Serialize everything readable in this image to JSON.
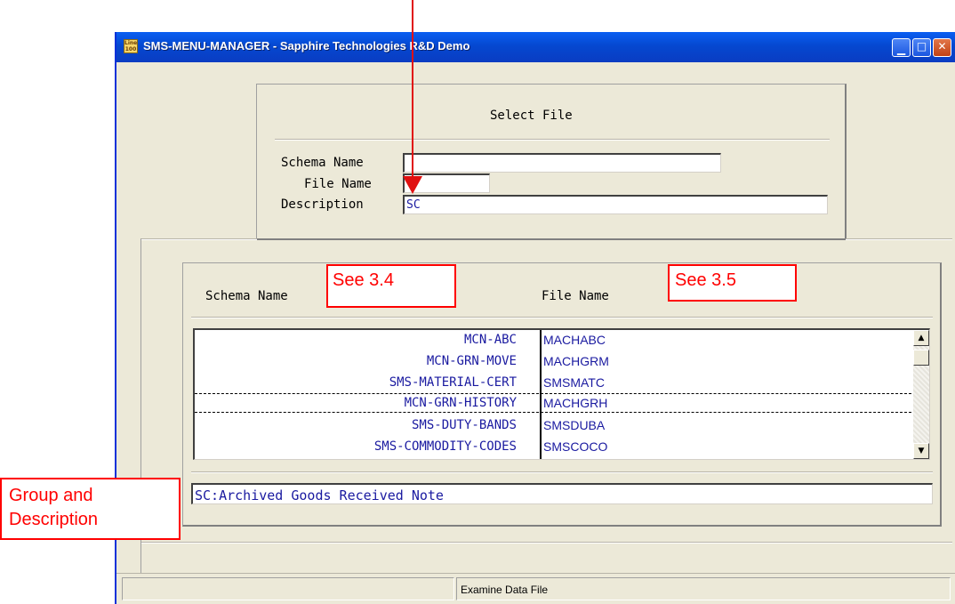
{
  "window": {
    "title": "SMS-MENU-MANAGER - Sapphire Technologies R&D Demo",
    "app_icon_text": [
      "Line",
      "100"
    ],
    "icons": {
      "minimize": "minimize-icon",
      "maximize": "maximize-icon",
      "close": "close-icon"
    }
  },
  "select_file": {
    "heading": "Select File",
    "schema_label": "Schema Name",
    "schema_value": "",
    "file_label": "File Name",
    "file_value": "",
    "description_label": "Description",
    "description_value": "SC"
  },
  "results": {
    "col_schema": "Schema Name",
    "col_file": "File Name",
    "rows": [
      {
        "schema": "MCN-ABC",
        "file": "MACHABC"
      },
      {
        "schema": "MCN-GRN-MOVE",
        "file": "MACHGRM"
      },
      {
        "schema": "SMS-MATERIAL-CERT",
        "file": "SMSMATC"
      },
      {
        "schema": "MCN-GRN-HISTORY",
        "file": "MACHGRH"
      },
      {
        "schema": "SMS-DUTY-BANDS",
        "file": "SMSDUBA"
      },
      {
        "schema": "SMS-COMMODITY-CODES",
        "file": "SMSCOCO"
      }
    ],
    "selected_row": 3,
    "group_description": "SC:Archived Goods Received Note"
  },
  "status": {
    "message": "Examine Data File"
  },
  "annotations": {
    "see_34": "See 3.4",
    "see_35": "See 3.5",
    "group_line1": "Group and",
    "group_line2": "Description",
    "color": "#ff0000"
  }
}
